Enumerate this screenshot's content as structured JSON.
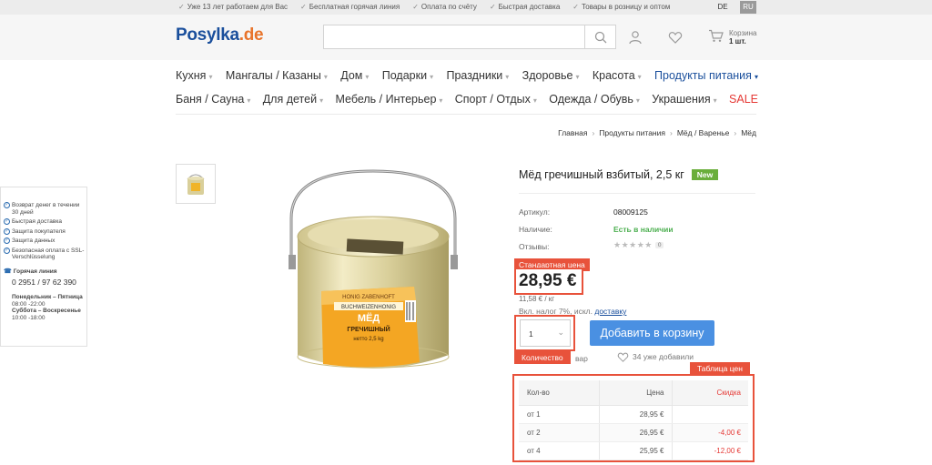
{
  "topbar": {
    "items": [
      "Уже 13 лет работаем для Вас",
      "Бесплатная горячая линия",
      "Оплата по счёту",
      "Быстрая доставка",
      "Товары в розницу и оптом"
    ],
    "lang_de": "DE",
    "lang_ru": "RU"
  },
  "header": {
    "logo_main": "Posylka",
    "logo_tld": ".de",
    "search": {
      "value": "",
      "placeholder": ""
    },
    "cart_label": "Корзина",
    "cart_count": "1 шт."
  },
  "nav_row1": [
    "Кухня",
    "Мангалы / Казаны",
    "Дом",
    "Подарки",
    "Праздники",
    "Здоровье",
    "Красота",
    "Продукты питания"
  ],
  "nav_row2": [
    "Баня / Сауна",
    "Для детей",
    "Мебель / Интерьер",
    "Спорт / Отдых",
    "Одежда / Обувь",
    "Украшения",
    "SALE"
  ],
  "breadcrumb": [
    "Главная",
    "Продукты питания",
    "Мёд / Варенье",
    "Мёд"
  ],
  "sidebar": {
    "benefits": [
      "Возврат денег в течении 30 дней",
      "Быстрая доставка",
      "Защита покупателя",
      "Защита данных",
      "Безопасная оплата с SSL-Verschlüsselung"
    ],
    "hotline_label": "Горячая линия",
    "hotline_phone": "0 2951 / 97 62 390",
    "weekdays_label": "Понедельник – Пятница",
    "weekdays_hours": "08:00 -22:00",
    "weekend_label": "Суббота – Воскресенье",
    "weekend_hours": "10:00 -18:00"
  },
  "product": {
    "title": "Мёд гречишный взбитый, 2,5 кг",
    "badge": "New",
    "article_label": "Артикул:",
    "article_value": "08009125",
    "availability_label": "Наличие:",
    "availability_value": "Есть в наличии",
    "reviews_label": "Отзывы:",
    "rating": 0,
    "stars": "★★★★★",
    "review_count": "0",
    "label_image_lines": [
      "HONIG ZABENHOFT",
      "BUCHWEIZENHONIG",
      "МЁД",
      "ГРЕЧИШНЫЙ",
      "нетто 2,5 kg"
    ],
    "standard_price_label": "Стандартная цена",
    "price": "28,95 €",
    "unit_price": "11,58 € / кг",
    "tax_text": "Вкл. налог 7%, искл.",
    "tax_link": "доставку",
    "quantity_value": "1",
    "quantity_label": "Количество",
    "add_to_cart": "Добавить в корзину",
    "compare_text": "вар",
    "liked_text": "34 уже добавили"
  },
  "price_table": {
    "label": "Таблица цен",
    "headers": [
      "Кол-во",
      "Цена",
      "Скидка"
    ],
    "rows": [
      {
        "qty": "от 1",
        "price": "28,95 €",
        "discount": ""
      },
      {
        "qty": "от 2",
        "price": "26,95 €",
        "discount": "-4,00 €"
      },
      {
        "qty": "от 4",
        "price": "25,95 €",
        "discount": "-12,00 €"
      }
    ]
  },
  "colors": {
    "accent_blue": "#4a90e2",
    "brand_blue": "#1a4f9c",
    "brand_orange": "#e8742b",
    "highlight_red": "#e8523b",
    "in_stock_green": "#4caf50",
    "new_badge_green": "#6aae3b"
  },
  "icons": [
    "check-icon",
    "search-icon",
    "user-icon",
    "heart-icon",
    "cart-icon",
    "chevron-down-icon",
    "phone-icon"
  ]
}
